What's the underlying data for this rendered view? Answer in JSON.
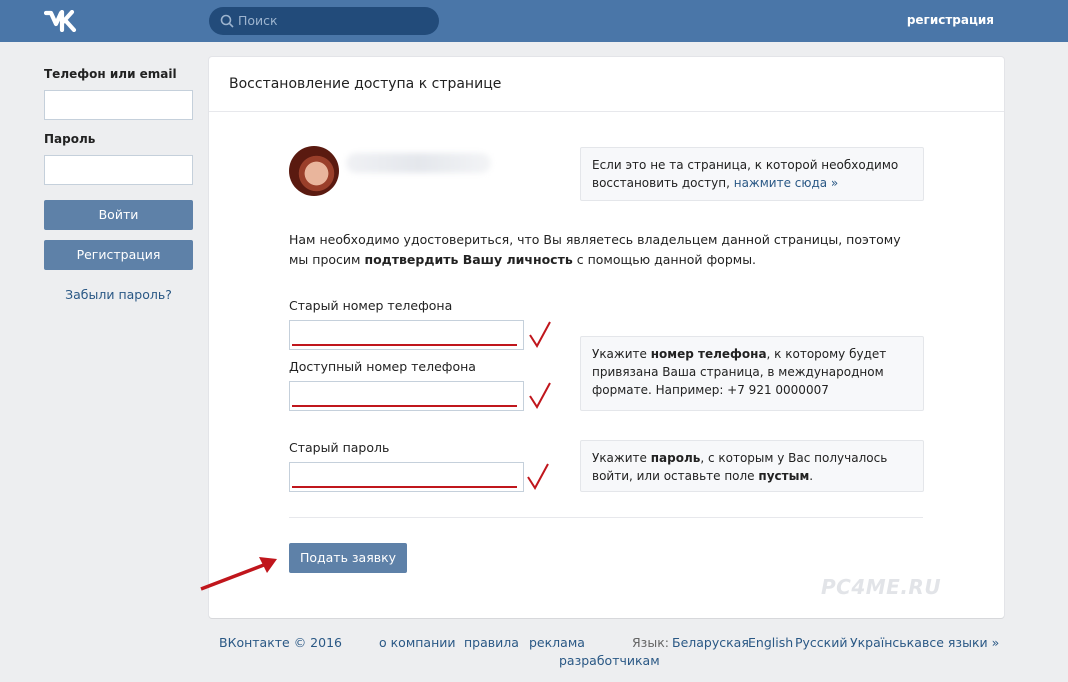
{
  "header": {
    "search_placeholder": "Поиск",
    "register_link": "регистрация",
    "brand_color": "#4a76a8"
  },
  "login": {
    "phone_label": "Телефон или email",
    "phone_value": "",
    "password_label": "Пароль",
    "password_value": "",
    "login_button": "Войти",
    "register_button": "Регистрация",
    "forgot_link": "Забыли пароль?"
  },
  "card": {
    "title": "Восстановление доступа к странице",
    "wrong_page_text": "Если это не та страница, к которой необходимо восстановить доступ,",
    "wrong_page_link": "нажмите сюда »",
    "intro_part1": "Нам необходимо удостовериться, что Вы являетесь владельцем данной страницы, поэтому мы просим",
    "intro_bold": "подтвердить Вашу личность",
    "intro_part2": "с помощью данной формы.",
    "fields": [
      {
        "label": "Старый номер телефона",
        "value": ""
      },
      {
        "label": "Доступный номер телефона",
        "value": ""
      },
      {
        "label": "Старый пароль",
        "value": ""
      }
    ],
    "phone_hint_part1": "Укажите",
    "phone_hint_bold": "номер телефона",
    "phone_hint_part2": ", к которому будет привязана Ваша страница, в международном формате. Например: +7 921 0000007",
    "password_hint_part1": "Укажите",
    "password_hint_bold1": "пароль",
    "password_hint_part2": ", с которым у Вас получалось войти, или оставьте поле",
    "password_hint_bold2": "пустым",
    "password_hint_part3": ".",
    "submit_button": "Подать заявку",
    "watermark": "PC4ME.RU",
    "annotation_color": "#c0161c"
  },
  "footer": {
    "copyright": "ВКонтакте © 2016",
    "links": [
      "о компании",
      "правила",
      "реклама",
      "разработчикам"
    ],
    "language_label": "Язык:",
    "languages": [
      "Беларуская",
      "English",
      "Русский",
      "Українська",
      "все языки »"
    ]
  }
}
